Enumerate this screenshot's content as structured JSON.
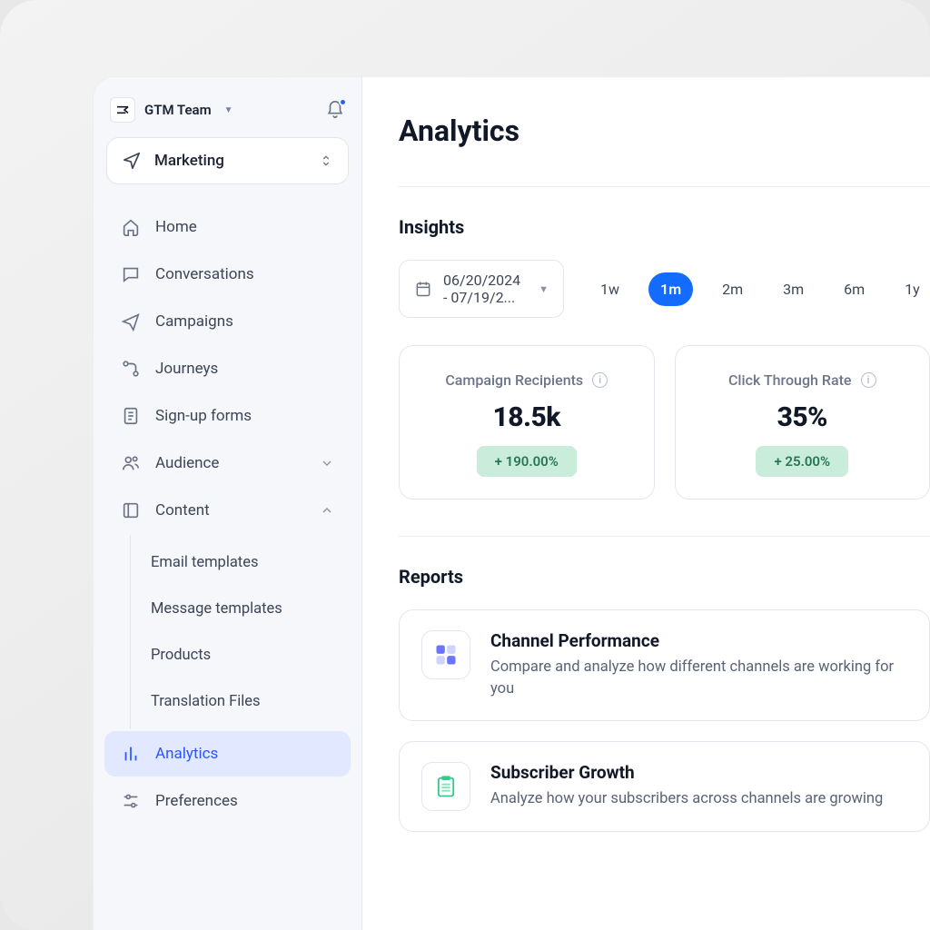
{
  "team": {
    "name": "GTM Team"
  },
  "workspace": {
    "label": "Marketing"
  },
  "nav": {
    "home": "Home",
    "conversations": "Conversations",
    "campaigns": "Campaigns",
    "journeys": "Journeys",
    "signup_forms": "Sign-up forms",
    "audience": "Audience",
    "content": "Content",
    "analytics": "Analytics",
    "preferences": "Preferences"
  },
  "content_children": {
    "email_templates": "Email templates",
    "message_templates": "Message templates",
    "products": "Products",
    "translation_files": "Translation Files"
  },
  "page": {
    "title": "Analytics",
    "insights_heading": "Insights",
    "reports_heading": "Reports"
  },
  "date_range": {
    "display": "06/20/2024 - 07/19/2..."
  },
  "ranges": {
    "w1": "1w",
    "m1": "1m",
    "m2": "2m",
    "m3": "3m",
    "m6": "6m",
    "y1": "1y"
  },
  "metrics": {
    "recipients": {
      "label": "Campaign Recipients",
      "value": "18.5k",
      "delta": "+ 190.00%"
    },
    "ctr": {
      "label": "Click Through Rate",
      "value": "35%",
      "delta": "+ 25.00%"
    }
  },
  "reports": {
    "channel": {
      "title": "Channel Performance",
      "desc": "Compare and analyze how different channels are working for you"
    },
    "growth": {
      "title": "Subscriber Growth",
      "desc": "Analyze how your subscribers across channels are growing"
    }
  },
  "colors": {
    "accent": "#146bff",
    "delta_bg": "#c9ecdb",
    "delta_text": "#277556"
  }
}
